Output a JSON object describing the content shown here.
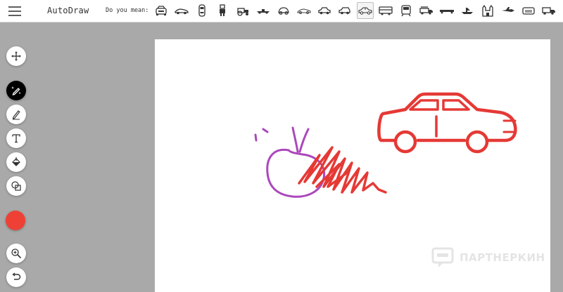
{
  "app": {
    "title": "AutoDraw"
  },
  "suggestions": {
    "label": "Do you mean:",
    "items": [
      {
        "icon": "car-front-icon"
      },
      {
        "icon": "race-car-icon"
      },
      {
        "icon": "car-top-view-icon"
      },
      {
        "icon": "robot-icon"
      },
      {
        "icon": "tractor-icon"
      },
      {
        "icon": "f1-car-icon"
      },
      {
        "icon": "beetle-car-icon"
      },
      {
        "icon": "sports-car-icon"
      },
      {
        "icon": "sedan-icon"
      },
      {
        "icon": "hatchback-icon"
      },
      {
        "icon": "sedan-outline-icon",
        "selected": true
      },
      {
        "icon": "bus-icon"
      },
      {
        "icon": "train-icon"
      },
      {
        "icon": "fire-truck-icon"
      },
      {
        "icon": "limousine-icon"
      },
      {
        "icon": "ship-icon"
      },
      {
        "icon": "castle-icon"
      },
      {
        "icon": "fighter-jet-icon"
      },
      {
        "icon": "car-front-grille-icon"
      },
      {
        "icon": "dump-truck-icon"
      }
    ]
  },
  "toolbar": {
    "tools": [
      "move-tool",
      "autodraw-tool",
      "draw-tool",
      "type-tool",
      "fill-tool",
      "shape-tool"
    ],
    "active_tool": "autodraw-tool",
    "color": "#ee4035",
    "zoom_tool": "zoom-in-tool",
    "undo_tool": "undo-tool"
  },
  "canvas": {
    "strokes": {
      "red": "#e53935",
      "purple": "#ab47bc"
    }
  },
  "watermark": {
    "text": "ПАРТНЕРКИН"
  }
}
